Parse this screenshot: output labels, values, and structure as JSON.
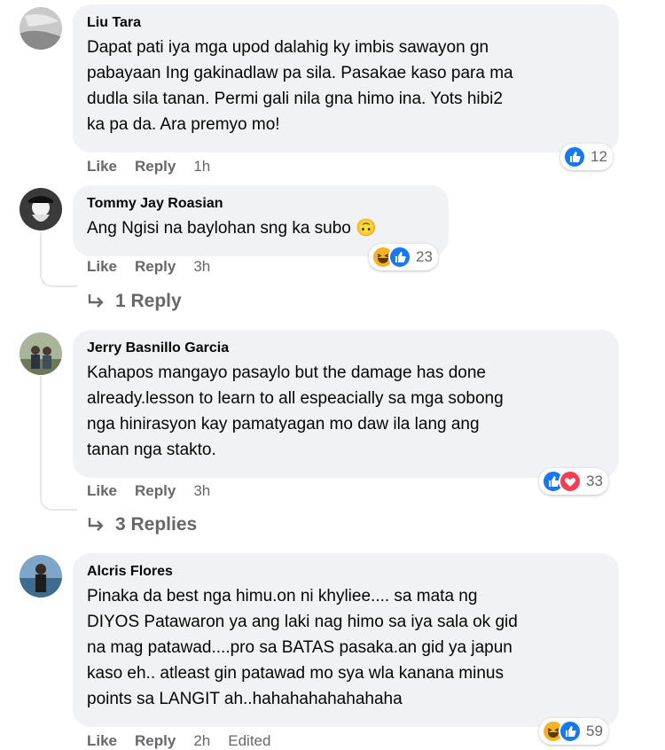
{
  "comments": [
    {
      "author": "Liu Tara",
      "text": "Dapat pati iya mga upod dalahig ky imbis sawayon gn\npabayaan Ing gakinadlaw pa sila. Pasakae kaso para ma\ndudla sila tanan. Permi gali nila gna himo ina. Yots hibi2\nka pa da. Ara premyo mo!",
      "like": "Like",
      "reply": "Reply",
      "time": "1h",
      "reaction_count": "12"
    },
    {
      "author": "Tommy Jay Roasian",
      "text": "Ang Ngisi na baylohan sng ka subo 🙃",
      "like": "Like",
      "reply": "Reply",
      "time": "3h",
      "reaction_count": "23",
      "replies_label": "1 Reply"
    },
    {
      "author": "Jerry Basnillo Garcia",
      "text": "Kahapos mangayo pasaylo but the damage has done\nalready.lesson to learn to all espeacially sa mga sobong\nnga hinirasyon kay pamatyagan mo daw ila lang ang\ntanan nga stakto.",
      "like": "Like",
      "reply": "Reply",
      "time": "3h",
      "reaction_count": "33",
      "replies_label": "3 Replies"
    },
    {
      "author": "Alcris Flores",
      "text": "Pinaka da best nga himu.on ni khyliee.... sa mata ng\nDIYOS Patawaron ya ang laki nag himo sa iya sala ok gid\nna mag patawad....pro sa BATAS pasaka.an gid ya japun\nkaso eh.. atleast gin patawad mo sya wla kanana minus\npoints sa LANGIT ah..hahahahahahahaha",
      "like": "Like",
      "reply": "Reply",
      "time": "2h",
      "edited": "Edited",
      "reaction_count": "59"
    }
  ],
  "colors": {
    "bubble": "#f0f2f5",
    "meta": "#65676b",
    "like": "#1877f2",
    "love": "#f33e58",
    "haha": "#f7b125"
  },
  "icons": [
    "like-reaction-icon",
    "love-reaction-icon",
    "haha-reaction-icon",
    "reply-arrow-icon"
  ]
}
